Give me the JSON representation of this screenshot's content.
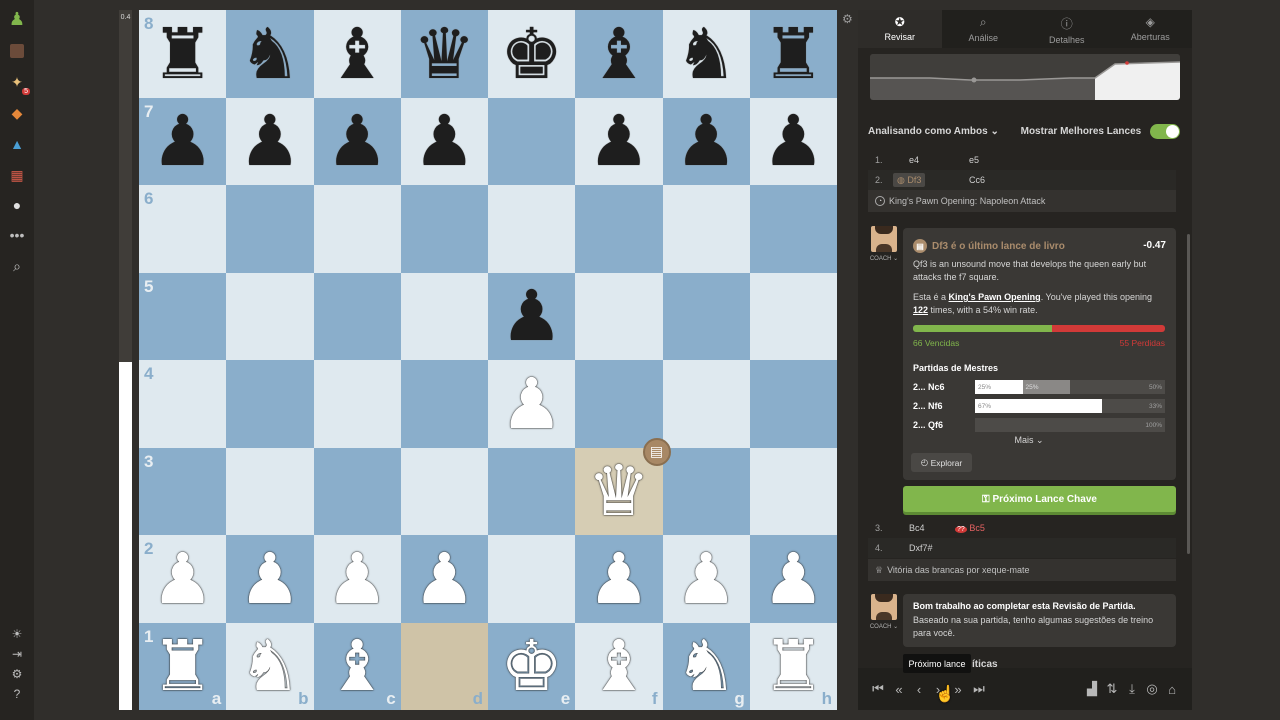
{
  "nav": {
    "icons": [
      "pawn-icon",
      "avatar-icon",
      "puzzle-icon",
      "lessons-icon",
      "learn-icon",
      "news-icon",
      "chat-icon",
      "more-icon",
      "search-icon",
      "theme-icon",
      "exit-icon",
      "settings-icon",
      "help-icon"
    ],
    "badge": "5"
  },
  "eval_bar": {
    "score": "0.4",
    "white_fraction": 0.497
  },
  "board": {
    "files": [
      "a",
      "b",
      "c",
      "d",
      "e",
      "f",
      "g",
      "h"
    ],
    "ranks": [
      "8",
      "7",
      "6",
      "5",
      "4",
      "3",
      "2",
      "1"
    ],
    "position": [
      [
        "bR",
        "bN",
        "bB",
        "bQ",
        "bK",
        "bB",
        "bN",
        "bR"
      ],
      [
        "bP",
        "bP",
        "bP",
        "bP",
        "",
        "bP",
        "bP",
        "bP"
      ],
      [
        "",
        "",
        "",
        "",
        "",
        "",
        "",
        ""
      ],
      [
        "",
        "",
        "",
        "",
        "bP",
        "",
        "",
        ""
      ],
      [
        "",
        "",
        "",
        "",
        "wP",
        "",
        "",
        ""
      ],
      [
        "",
        "",
        "",
        "",
        "",
        "wQ",
        "",
        ""
      ],
      [
        "wP",
        "wP",
        "wP",
        "wP",
        "",
        "wP",
        "wP",
        "wP"
      ],
      [
        "wR",
        "wN",
        "wB",
        "",
        "wK",
        "wB",
        "wN",
        "wR"
      ]
    ],
    "highlight_squares": [
      "d1",
      "f3"
    ],
    "book_badge_square": "f3",
    "book_icon": "book-icon"
  },
  "tabs": [
    {
      "label": "Revisar",
      "icon": "star-icon",
      "active": true
    },
    {
      "label": "Análise",
      "icon": "magnifier-icon",
      "active": false
    },
    {
      "label": "Detalhes",
      "icon": "info-icon",
      "active": false
    },
    {
      "label": "Aberturas",
      "icon": "cube-icon",
      "active": false
    }
  ],
  "options": {
    "analyzing": "Analisando como Ambos",
    "best_moves": "Mostrar Melhores Lances",
    "best_moves_on": true
  },
  "moves_top": [
    {
      "num": "1.",
      "white": "e4",
      "black": "e5"
    },
    {
      "num": "2.",
      "white": "Df3",
      "black": "Cc6"
    }
  ],
  "opening_name": "King's Pawn Opening: Napoleon Attack",
  "coach": {
    "label": "COACH",
    "heading": "Df3 é o último lance de livro",
    "eval": "-0.47",
    "text1": "Qf3 is an unsound move that develops the queen early but attacks the f7 square.",
    "text2_prefix": "Esta é a ",
    "text2_opening": "King's Pawn Opening",
    "text2_mid": ". You've played this opening ",
    "text2_count": "122",
    "text2_suffix": " times, with a 54% win rate.",
    "wins": "66 Vencidas",
    "losses": "55 Perdidas",
    "win_fraction": 0.55,
    "masters_title": "Partidas de Mestres",
    "masters": [
      {
        "move": "2... Nc6",
        "white": "25%",
        "draw": "25%",
        "black": "50%",
        "white_f": 0.25,
        "draw_f": 0.25
      },
      {
        "move": "2... Nf6",
        "white": "67%",
        "draw": "",
        "black": "33%",
        "white_f": 0.67,
        "draw_f": 0
      },
      {
        "move": "2... Qf6",
        "white": "",
        "draw": "",
        "black": "100%",
        "white_f": 0,
        "draw_f": 0
      }
    ],
    "more": "Mais",
    "explore": "Explorar"
  },
  "key_move_button": "Próximo Lance Chave",
  "moves_bottom": [
    {
      "num": "3.",
      "white": "Bc4",
      "black": "Bc5"
    },
    {
      "num": "4.",
      "white": "Dxf7#",
      "black": ""
    }
  ],
  "victory": "Vitória das brancas por xeque-mate",
  "coach2": {
    "label": "COACH",
    "title": "Bom trabalho ao completar esta Revisão de Partida.",
    "text": "Baseado na sua partida, tenho algumas sugestões de treino para você.",
    "partial": "íticas"
  },
  "tooltip": "Próximo lance",
  "controls": {
    "nav": [
      "first-move-icon",
      "prev-key-icon",
      "prev-move-icon",
      "next-move-icon",
      "next-key-icon",
      "last-move-icon"
    ],
    "tools": [
      "chart-icon",
      "flip-icon",
      "download-icon",
      "target-icon",
      "library-icon"
    ]
  }
}
